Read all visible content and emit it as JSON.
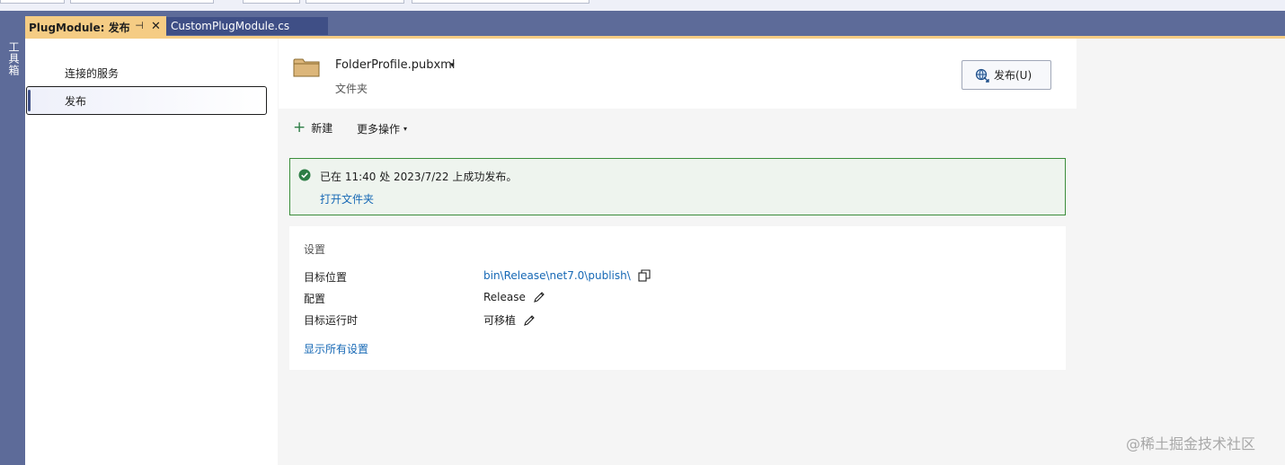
{
  "toolbox": {
    "label": "工具箱"
  },
  "tabs": {
    "active": {
      "label": "PlugModule: 发布",
      "pin_glyph": "⊣",
      "close_glyph": "✕"
    },
    "inactive": {
      "label": "CustomPlugModule.cs"
    }
  },
  "sidebar": {
    "items": [
      {
        "label": "连接的服务"
      },
      {
        "label": "发布"
      }
    ]
  },
  "profile": {
    "name": "FolderProfile.pubxml",
    "caret": "▾",
    "type": "文件夹",
    "publish_button": "发布(U)"
  },
  "actions": {
    "new_label": "新建",
    "new_glyph": "+",
    "more_label": "更多操作",
    "more_caret": "▾"
  },
  "status": {
    "message": "已在 11:40 处 2023/7/22 上成功发布。",
    "open_folder": "打开文件夹",
    "color": "#3b8d3b"
  },
  "settings": {
    "title": "设置",
    "rows": [
      {
        "label": "目标位置",
        "value": "bin\\Release\\net7.0\\publish\\"
      },
      {
        "label": "配置",
        "value": "Release"
      },
      {
        "label": "目标运行时",
        "value": "可移植"
      }
    ],
    "show_all": "显示所有设置"
  },
  "colors": {
    "accent": "#f5cc84",
    "chrome": "#5d6b99",
    "link": "#1668b5"
  },
  "watermark": "@稀土掘金技术社区"
}
